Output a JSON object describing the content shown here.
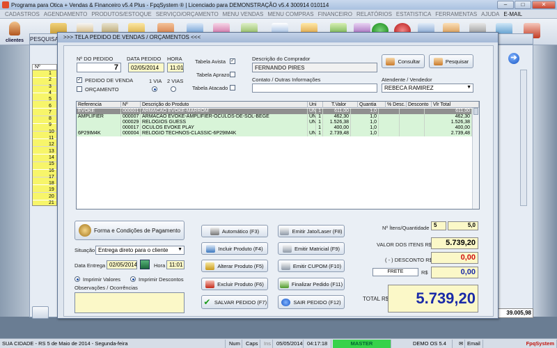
{
  "app": {
    "title": "Programa para Otica + Vendas & Financeiro v5.4 Plus - FpqSystem ® | Licenciado para  DEMONSTRAÇÃO v5.4 300914 010114"
  },
  "menu": [
    "CADASTROS",
    "AGENDAMENTO",
    "PRODUTOS/ESTOQUE",
    "SERVIÇO/ORÇAMENTO",
    "MENU VENDAS",
    "MENU COMPRAS",
    "FINANCEIRO",
    "RELATÓRIOS",
    "ESTATISTICA",
    "FERRAMENTAS",
    "AJUDA",
    "E-MAIL"
  ],
  "toolbar": {
    "clientes_label": "clientes"
  },
  "bg_window": {
    "title": "PESQUISA",
    "col_header": "Nº",
    "row_numbers": [
      "1",
      "2",
      "3",
      "4",
      "5",
      "6",
      "7",
      "8",
      "9",
      "10",
      "11",
      "12",
      "13",
      "14",
      "15",
      "16",
      "17",
      "18",
      "19",
      "20",
      "21"
    ],
    "total": "39.005,98"
  },
  "dialog": {
    "title": ">>>  TELA PEDIDO DE VENDAS / ORÇAMENTOS  <<<",
    "numero_pedido_label": "Nº DO PEDIDO",
    "numero_pedido": "7",
    "data_pedido_label": "DATA PEDIDO",
    "data_pedido": "02/05/2014",
    "hora_label": "HORA",
    "hora": "11:01",
    "pedido_venda_label": "PEDIDO DE VENDA",
    "orcamento_label": "ORÇAMENTO",
    "via1_label": "1 VIA",
    "via2_label": "2 VIAS",
    "tabela_avista": "Tabela Avista",
    "tabela_aprazo": "Tabela Aprazo",
    "tabela_atacado": "Tabela Atacado",
    "comprador_label": "Descrição do Comprador",
    "comprador": "FERNANDO PIRES",
    "contato_label": "Contato / Outras Informações",
    "contato": "",
    "consultar": "Consultar",
    "pesquisar": "Pesquisar",
    "atendente_label": "Atendente / Vendedor",
    "atendente": "REBECA RAMIREZ"
  },
  "grid": {
    "headers": [
      "Referencia",
      "Nº",
      "Descrição do Produto",
      "Uni",
      "T.Valor",
      "Quantia",
      "% Desc.",
      "Desconto",
      "Vlr Total"
    ],
    "rows": [
      [
        "EVOKE",
        "000001",
        "ARMACAO EVOKE-MARROM",
        "UNI",
        "1",
        "611,00",
        "1,0",
        "",
        "",
        "611,00"
      ],
      [
        "AMPLIFIER",
        "000007",
        "ARMACAO EVOKE-AMPLIFIER-OCULOS-DE-SOL-BEGE",
        "UNI",
        "1",
        "462,30",
        "1,0",
        "",
        "",
        "462,30"
      ],
      [
        "",
        "000029",
        "RELOGIOS GUESS",
        "UNI",
        "1",
        "1.526,38",
        "1,0",
        "",
        "",
        "1.526,38"
      ],
      [
        "",
        "000017",
        "OCULOS EVOKE PLAY",
        "",
        "1",
        "400,00",
        "1,0",
        "",
        "",
        "400,00"
      ],
      [
        "6P29IM4K",
        "000004",
        "RELOGIO TECHNOS-CLASSIC-6P29IM4K",
        "UNI",
        "1",
        "2.739,48",
        "1,0",
        "",
        "",
        "2.739,48"
      ]
    ]
  },
  "bottom": {
    "forma_pagamento": "Forma e Condições de Pagamento",
    "situacao_label": "Situação",
    "situacao": "Entrega direto para o cliente",
    "data_entrega_label": "Data Entrega",
    "data_entrega": "02/05/2014",
    "hora_label": "Hora",
    "hora": "11:01",
    "imprimir_valores": "Imprimir Valores",
    "imprimir_descontos": "Imprimir Descontos",
    "observacoes_label": "Observações / Ocorrências",
    "observacoes": ""
  },
  "actions": {
    "automatico": "Automático     (F3)",
    "incluir": "Incluir Produto  (F4)",
    "alterar": "Alterar Produto  (F5)",
    "excluir": "Excluir Produto  (F6)",
    "salvar": "SALVAR PEDIDO  (F7)",
    "jato": "Emitir Jato/Laser  (F8)",
    "matricial": "Emitir Matricial   (F9)",
    "cupom": "Emitir CUPOM   (F10)",
    "finalizar": "Finalizar Pedido  (F11)",
    "sair": "SAIR  PEDIDO   (F12)"
  },
  "totals": {
    "itens_label": "Nº Ítens/Quantidade",
    "itens": "5",
    "quantidade": "5,0",
    "valor_itens_label": "VALOR DOS ITENS R$",
    "valor_itens": "5.739,20",
    "desconto_label": "( - ) DESCONTO R$",
    "desconto": "0,00",
    "frete_label": "FRETE",
    "frete_currency": "R$",
    "frete": "0,00",
    "total_label": "TOTAL R$",
    "total": "5.739,20"
  },
  "status": {
    "city": "SUA CIDADE - RS   5 de Maio de 2014 - Segunda-feira",
    "num": "Num",
    "caps": "Caps",
    "ins": "Ins",
    "date": "05/05/2014",
    "time": "04:17:18",
    "master": "MASTER",
    "demo": "DEMO OS 5.4",
    "email": "Email",
    "brand": "FpqSystem"
  },
  "colors": {
    "row_selected": "#8f8f8f",
    "row_green": "#d8f4d8",
    "valor_itens": "#000000",
    "desconto": "#d01010",
    "total_text": "#1a2aa8",
    "total_bg": "#fbf8c8"
  }
}
